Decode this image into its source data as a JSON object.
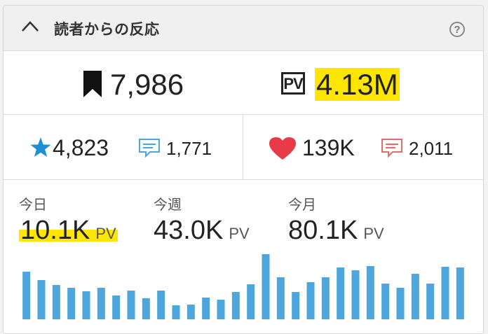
{
  "header": {
    "title": "読者からの反応",
    "help_icon": "?"
  },
  "summary": {
    "bookmarks": "7,986",
    "pv_badge": "PV",
    "pageviews": "4.13M"
  },
  "reactions": {
    "stars": "4,823",
    "comments_blue": "1,771",
    "likes": "139K",
    "comments_red": "2,011"
  },
  "periods": [
    {
      "label": "今日",
      "value": "10.1K",
      "unit": "PV"
    },
    {
      "label": "今週",
      "value": "43.0K",
      "unit": "PV"
    },
    {
      "label": "今月",
      "value": "80.1K",
      "unit": "PV"
    }
  ],
  "colors": {
    "star": "#1e8fd5",
    "comment_blue": "#4aa7dd",
    "heart": "#e83a48",
    "comment_red": "#e66b6b",
    "highlight": "#ffe600",
    "bar": "#4da6dc"
  },
  "chart_data": {
    "type": "bar",
    "values": [
      68,
      56,
      49,
      45,
      40,
      45,
      34,
      41,
      30,
      41,
      20,
      21,
      31,
      28,
      39,
      50,
      93,
      60,
      39,
      53,
      60,
      74,
      70,
      76,
      51,
      45,
      65,
      51,
      75,
      74
    ]
  }
}
